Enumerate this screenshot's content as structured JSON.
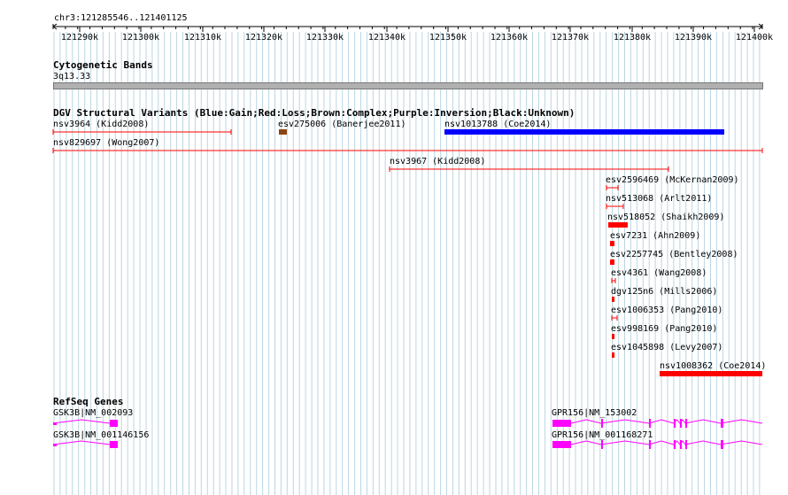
{
  "ruler": {
    "coordinate_label": "chr3:121285546..121401125",
    "ticks": [
      "121290k",
      "121300k",
      "121310k",
      "121320k",
      "121330k",
      "121340k",
      "121350k",
      "121360k",
      "121370k",
      "121380k",
      "121390k",
      "121400k"
    ]
  },
  "cytobands": {
    "title": "Cytogenetic Bands",
    "band_label": "3q13.33",
    "band_color": "#b0b0b0"
  },
  "dgv": {
    "title": "DGV Structural Variants (Blue:Gain;Red:Loss;Brown:Complex;Purple:Inversion;Black:Unknown)",
    "colors": {
      "loss": "#ff0000",
      "gain": "#0000ff",
      "complex": "#8b4513"
    },
    "variants": [
      {
        "label": "nsv3964 (Kidd2008)",
        "type": "loss",
        "style": "span"
      },
      {
        "label": "esv275006 (Banerjee2011)",
        "type": "complex",
        "style": "block"
      },
      {
        "label": "nsv1013788 (Coe2014)",
        "type": "gain",
        "style": "block"
      },
      {
        "label": "nsv829697 (Wong2007)",
        "type": "loss",
        "style": "span"
      },
      {
        "label": "nsv3967 (Kidd2008)",
        "type": "loss",
        "style": "span"
      },
      {
        "label": "esv2596469 (McKernan2009)",
        "type": "loss",
        "style": "span"
      },
      {
        "label": "nsv513068 (Arlt2011)",
        "type": "loss",
        "style": "span"
      },
      {
        "label": "nsv518052 (Shaikh2009)",
        "type": "loss",
        "style": "block"
      },
      {
        "label": "esv7231 (Ahn2009)",
        "type": "loss",
        "style": "block"
      },
      {
        "label": "esv2257745 (Bentley2008)",
        "type": "loss",
        "style": "block"
      },
      {
        "label": "esv4361 (Wang2008)",
        "type": "loss",
        "style": "span"
      },
      {
        "label": "dgv125n6 (Mills2006)",
        "type": "loss",
        "style": "block"
      },
      {
        "label": "esv1006353 (Pang2010)",
        "type": "loss",
        "style": "span"
      },
      {
        "label": "esv998169 (Pang2010)",
        "type": "loss",
        "style": "block"
      },
      {
        "label": "esv1045898 (Levy2007)",
        "type": "loss",
        "style": "block"
      },
      {
        "label": "nsv1008362 (Coe2014)",
        "type": "loss",
        "style": "block"
      }
    ]
  },
  "refseq": {
    "title": "RefSeq Genes",
    "color": "#ff00ff",
    "genes": [
      {
        "label": "GSK3B|NM_002093"
      },
      {
        "label": "GSK3B|NM_001146156"
      },
      {
        "label": "GPR156|NM_153002"
      },
      {
        "label": "GPR156|NM_001168271"
      }
    ]
  }
}
